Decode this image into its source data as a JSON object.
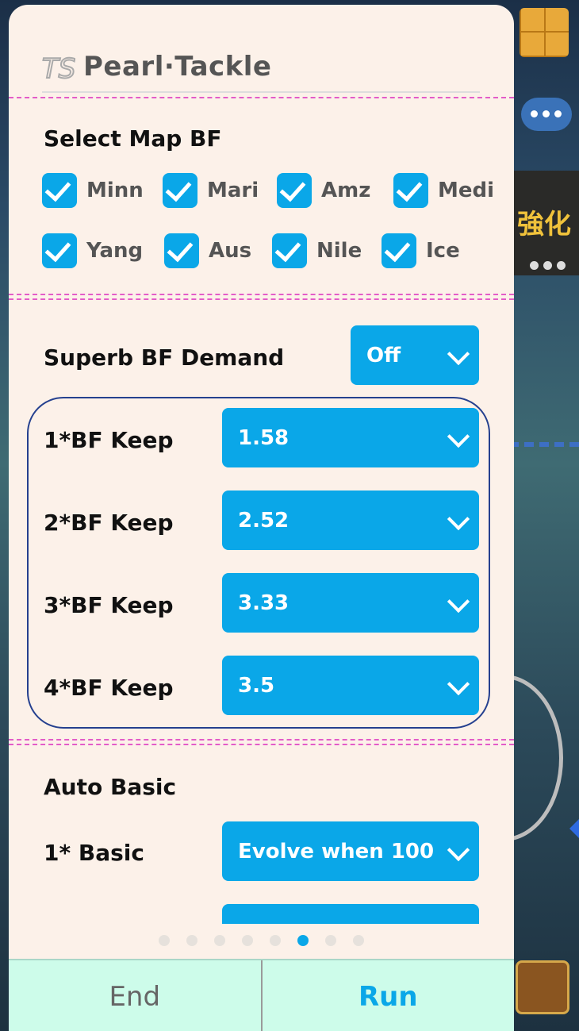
{
  "app": {
    "title": "Pearl·Tackle",
    "logo_icon": "ts-logo-icon"
  },
  "map_section": {
    "title": "Select Map BF",
    "maps": [
      {
        "label": "Minn",
        "checked": true
      },
      {
        "label": "Mari",
        "checked": true
      },
      {
        "label": "Amz",
        "checked": true
      },
      {
        "label": "Medi",
        "checked": true
      },
      {
        "label": "Yang",
        "checked": true
      },
      {
        "label": "Aus",
        "checked": true
      },
      {
        "label": "Nile",
        "checked": true
      },
      {
        "label": "Ice",
        "checked": true
      }
    ]
  },
  "superb": {
    "label": "Superb BF Demand",
    "value": "Off"
  },
  "keep": [
    {
      "label": "1*BF Keep",
      "value": "1.58"
    },
    {
      "label": "2*BF Keep",
      "value": "2.52"
    },
    {
      "label": "3*BF Keep",
      "value": "3.33"
    },
    {
      "label": "4*BF Keep",
      "value": "3.5"
    }
  ],
  "auto_basic": {
    "title": "Auto Basic",
    "rows": [
      {
        "label": "1* Basic",
        "value": "Evolve when 100"
      }
    ]
  },
  "pager": {
    "count": 8,
    "active": 6
  },
  "footer": {
    "end_label": "End",
    "run_label": "Run"
  },
  "background": {
    "banner_text": "強化"
  },
  "colors": {
    "accent": "#0aa7e8",
    "panel": "#fcf1e9",
    "footer": "#cdfcea",
    "separator": "#e35cc8",
    "group_border": "#25408f"
  }
}
